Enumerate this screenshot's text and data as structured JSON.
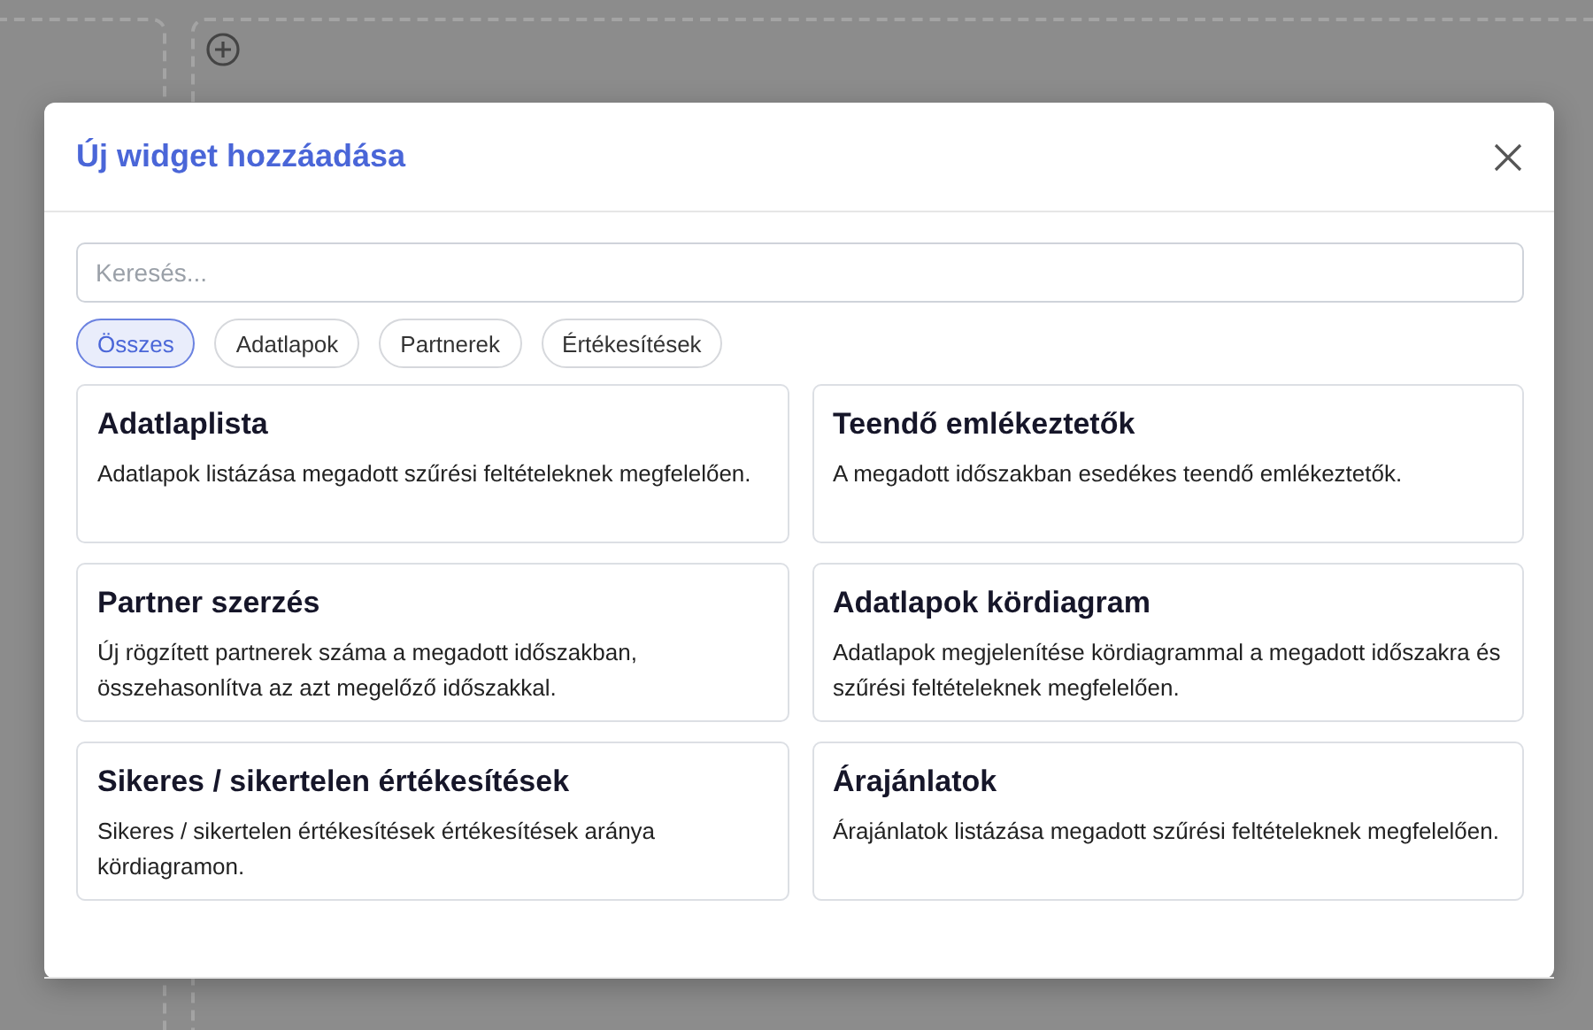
{
  "dialog": {
    "title": "Új widget hozzáadása"
  },
  "search": {
    "placeholder": "Keresés..."
  },
  "filters": [
    {
      "label": "Összes",
      "selected": true
    },
    {
      "label": "Adatlapok",
      "selected": false
    },
    {
      "label": "Partnerek",
      "selected": false
    },
    {
      "label": "Értékesítések",
      "selected": false
    }
  ],
  "widgets": [
    {
      "title": "Adatlaplista",
      "description": "Adatlapok listázása megadott szűrési feltételeknek megfelelően."
    },
    {
      "title": "Teendő emlékeztetők",
      "description": "A megadott időszakban esedékes teendő emlékeztetők."
    },
    {
      "title": "Partner szerzés",
      "description": "Új rögzített partnerek száma a megadott időszakban, összehasonlítva az azt megelőző időszakkal."
    },
    {
      "title": "Adatlapok kördiagram",
      "description": "Adatlapok megjelenítése kördiagrammal a megadott időszakra és szűrési feltételeknek megfelelően."
    },
    {
      "title": "Sikeres / sikertelen értékesítések",
      "description": "Sikeres / sikertelen értékesítések értékesítések aránya kördiagramon."
    },
    {
      "title": "Árajánlatok",
      "description": "Árajánlatok listázása megadott szűrési feltételeknek megfelelően."
    }
  ]
}
